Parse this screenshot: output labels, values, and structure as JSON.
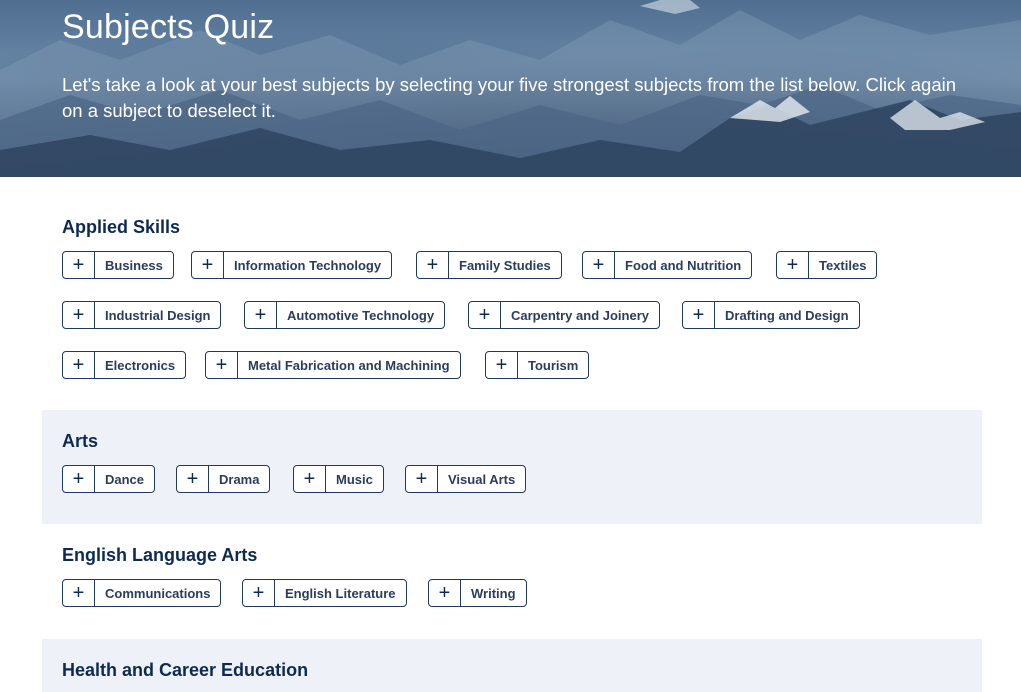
{
  "hero": {
    "title": "Subjects Quiz",
    "intro": "Let's take a look at your best subjects by selecting your five strongest subjects from the list below. Click again on a subject to deselect it."
  },
  "icons": {
    "add": "+"
  },
  "colors": {
    "heading": "#0c2a52",
    "chip_border": "#1f3a60",
    "shaded_section": "#eef2f8"
  },
  "sections": [
    {
      "title": "Applied Skills",
      "subjects": [
        "Business",
        "Information Technology",
        "Family Studies",
        "Food and Nutrition",
        "Textiles",
        "Industrial Design",
        "Automotive Technology",
        "Carpentry and Joinery",
        "Drafting and Design",
        "Electronics",
        "Metal Fabrication and Machining",
        "Tourism"
      ]
    },
    {
      "title": "Arts",
      "subjects": [
        "Dance",
        "Drama",
        "Music",
        "Visual Arts"
      ]
    },
    {
      "title": "English Language Arts",
      "subjects": [
        "Communications",
        "English Literature",
        "Writing"
      ]
    },
    {
      "title": "Health and Career Education",
      "subjects": []
    }
  ]
}
